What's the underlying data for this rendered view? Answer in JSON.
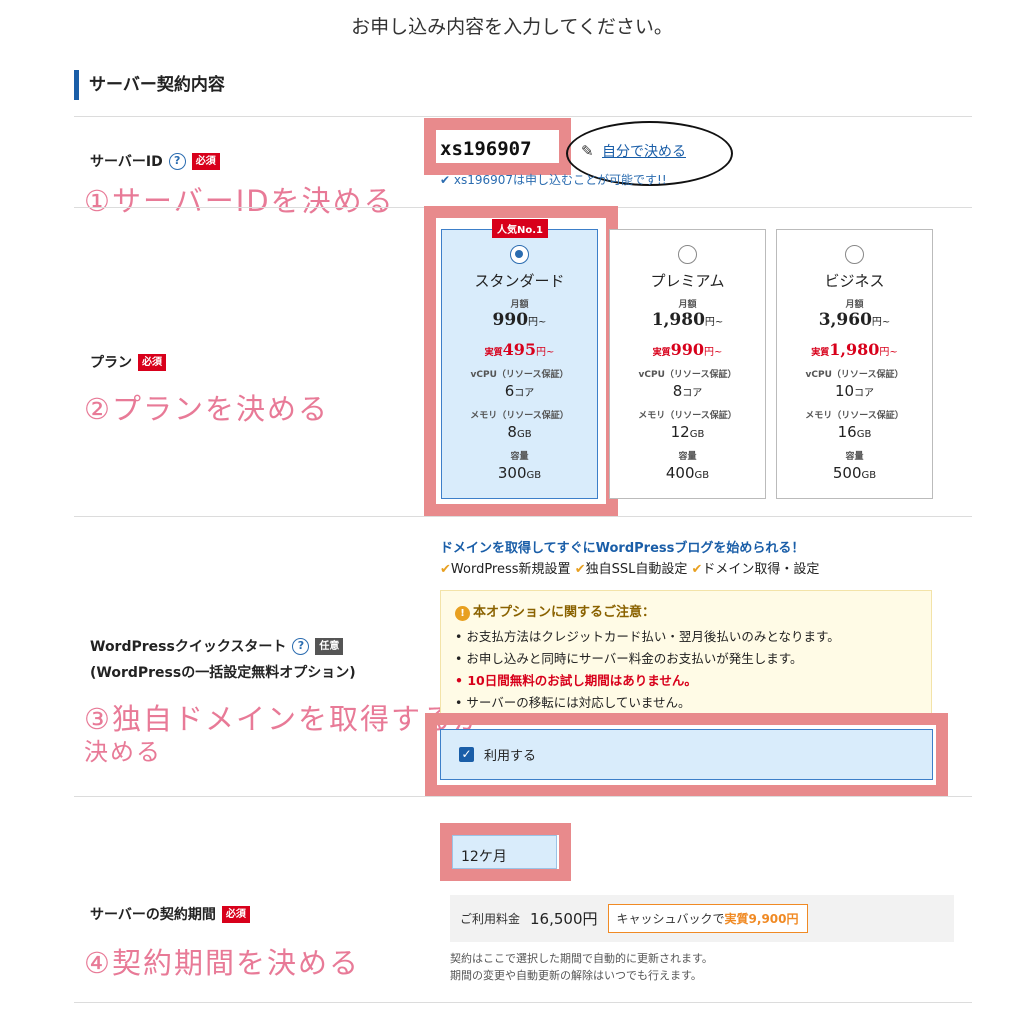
{
  "page_heading": "お申し込み内容を入力してください。",
  "section_title": "サーバー契約内容",
  "server_id": {
    "label": "サーバーID",
    "required_badge": "必須",
    "value": "xs196907",
    "self_decide_link": "自分で決める",
    "availability": "xs196907は申し込むことが可能です!!",
    "annotation": "①サーバーIDを決める"
  },
  "plan": {
    "label": "プラン",
    "required_badge": "必須",
    "annotation": "②プランを決める",
    "popular_badge": "人気No.1",
    "monthly_label": "月額",
    "real_label": "実質",
    "cpu_label": "vCPU（リソース保証）",
    "mem_label": "メモリ（リソース保証）",
    "disk_label": "容量",
    "yen_suffix": "円~",
    "core_unit": "コア",
    "gb_unit": "GB",
    "items": [
      {
        "name": "スタンダード",
        "price": "990",
        "real": "495",
        "cpu": "6",
        "mem": "8",
        "disk": "300",
        "selected": true
      },
      {
        "name": "プレミアム",
        "price": "1,980",
        "real": "990",
        "cpu": "8",
        "mem": "12",
        "disk": "400",
        "selected": false
      },
      {
        "name": "ビジネス",
        "price": "3,960",
        "real": "1,980",
        "cpu": "10",
        "mem": "16",
        "disk": "500",
        "selected": false
      }
    ]
  },
  "wp": {
    "label_line1": "WordPressクイックスタート",
    "optional_badge": "任意",
    "label_line2": "(WordPressの一括設定無料オプション)",
    "promo_head": "ドメインを取得してすぐにWordPressブログを始められる！",
    "features": [
      "WordPress新規設置",
      "独自SSL自動設定",
      "ドメイン取得・設定"
    ],
    "notice_title": "本オプションに関するご注意：",
    "notice_items": [
      {
        "text": "お支払方法はクレジットカード払い・翌月後払いのみとなります。",
        "red": false
      },
      {
        "text": "お申し込みと同時にサーバー料金のお支払いが発生します。",
        "red": false
      },
      {
        "text": "10日間無料のお試し期間はありません。",
        "red": true
      },
      {
        "text": "サーバーの移転には対応していません。",
        "red": false
      }
    ],
    "use_label": "利用する",
    "annotation_line1": "③独自ドメインを取得するか",
    "annotation_line2": "決める"
  },
  "period": {
    "label": "サーバーの契約期間",
    "required_badge": "必須",
    "selected": "12ケ月",
    "fee_label": "ご利用料金",
    "fee_value": "16,500円",
    "cashback_prefix": "キャッシュバックで",
    "cashback_value": "実質9,900円",
    "note_line1": "契約はここで選択した期間で自動的に更新されます。",
    "note_line2": "期間の変更や自動更新の解除はいつでも行えます。",
    "annotation": "④契約期間を決める"
  },
  "colors": {
    "accent": "#1a5ea8",
    "required": "#d8001b",
    "annotation": "#e87a97",
    "highlight_border": "#e88a8c"
  }
}
